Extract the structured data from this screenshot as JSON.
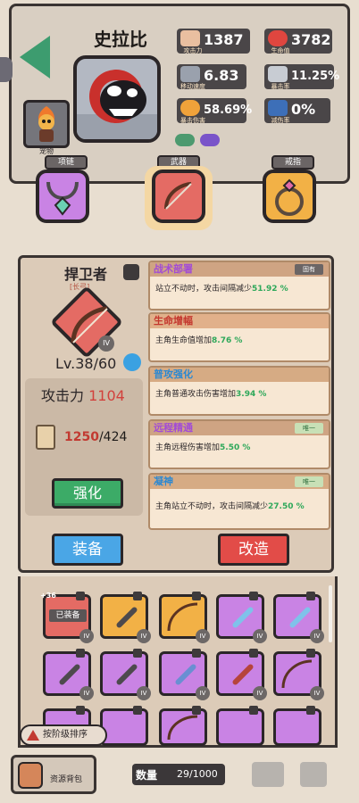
{
  "hero": {
    "name": "史拉比",
    "pet_label": "宠物"
  },
  "stats": {
    "attack": {
      "value": "1387",
      "label": "攻击力"
    },
    "hp": {
      "value": "3782",
      "label": "生命值"
    },
    "move_speed": {
      "value": "6.83",
      "label": "移动速度"
    },
    "crit_rate": {
      "value": "11.25%",
      "label": "暴击率"
    },
    "crit_damage": {
      "value": "58.69%",
      "label": "暴击伤害"
    },
    "damage_reduction": {
      "value": "0%",
      "label": "减伤率"
    }
  },
  "gear_slots": {
    "necklace": "项链",
    "weapon": "武器",
    "ring": "戒指"
  },
  "weapon": {
    "name": "捍卫者",
    "subtitle": "[长弓]",
    "tier": "IV",
    "level": "Lv.38/60",
    "attack_label": "攻击力",
    "attack_value": "1104",
    "cost_have": "1250",
    "cost_need": "/424",
    "strengthen_label": "强化"
  },
  "affixes": [
    {
      "title": "战术部署",
      "tag": "固有",
      "text": "站立不动时，攻击间隔减少",
      "value": "51.92 %"
    },
    {
      "title": "生命增幅",
      "tag": "",
      "text": "主角生命值增加",
      "value": "8.76 %"
    },
    {
      "title": "普攻强化",
      "tag": "",
      "text": "主角普通攻击伤害增加",
      "value": "3.94 %"
    },
    {
      "title": "远程精通",
      "tag": "唯一",
      "text": "主角远程伤害增加",
      "value": "5.50 %"
    },
    {
      "title": "凝神",
      "tag": "唯一",
      "text": "主角站立不动时，攻击间隔减少",
      "value": "27.50 %"
    }
  ],
  "actions": {
    "equip": "装备",
    "reforge": "改造"
  },
  "inventory": {
    "first_item_count": "+36",
    "equipped_badge": "已装备",
    "tier": "IV",
    "sort_label": "按阶级排序",
    "bag_label": "资源背包",
    "qty_label": "数量",
    "qty_value": "29/1000"
  },
  "colors": {
    "green_button": "#3cab67",
    "blue_button": "#4aa6e6",
    "red_button": "#e24c48",
    "purple_item": "#c983e4",
    "orange_item": "#f2b146",
    "red_item": "#e46b64"
  }
}
